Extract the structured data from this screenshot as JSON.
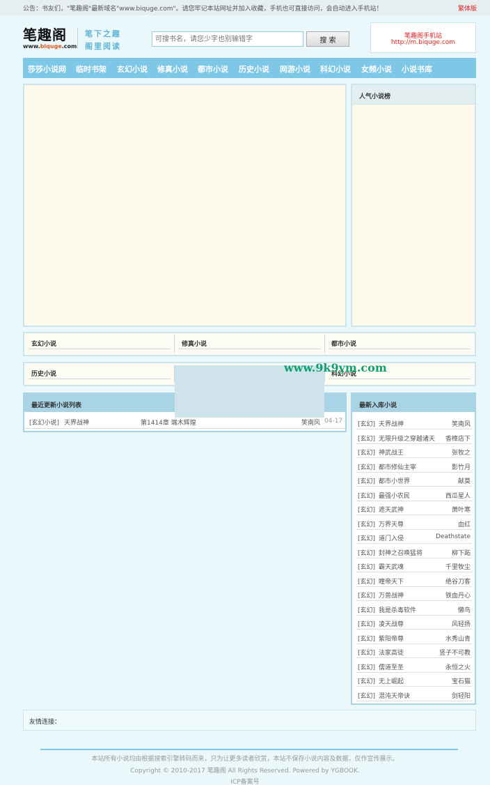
{
  "notice": {
    "text": "公告：书友们，\"笔趣阁\"最新域名\"www.biquge.com\"。请您牢记本站网址并加入收藏，手机也可直接访问，会自动进入手机站！",
    "traditional_label": "繁体版"
  },
  "header": {
    "logo_title": "笔趣阁",
    "logo_url_pre": "www.",
    "logo_url_hl": "biquge",
    "logo_url_post": ".com",
    "slogan_line1": "笔下之趣",
    "slogan_line2": "阁里阅读",
    "search_placeholder": "可搜书名，请您少字也别输错字",
    "search_button": "搜 索",
    "mobile_title": "笔趣阁手机站",
    "mobile_url": "http://m.biquge.com"
  },
  "nav": [
    "莎莎小说网",
    "临时书架",
    "玄幻小说",
    "修真小说",
    "都市小说",
    "历史小说",
    "网游小说",
    "科幻小说",
    "女频小说",
    "小说书库"
  ],
  "popular": {
    "title": "人气小说榜"
  },
  "categories_row1": [
    "玄幻小说",
    "修真小说",
    "都市小说"
  ],
  "categories_row2": [
    "历史小说",
    "",
    "科幻小说"
  ],
  "watermark": "www.9k9ym.com",
  "latest": {
    "title": "最近更新小说列表",
    "rows": [
      {
        "category": "[玄幻小说]",
        "title": "天界战神",
        "chapter": "第1414章 端木辉煌",
        "author": "笑南风",
        "date": "04-17"
      }
    ]
  },
  "newest": {
    "title": "最新入库小说",
    "rows": [
      {
        "category": "[玄幻]",
        "title": "天界战神",
        "author": "笑南风"
      },
      {
        "category": "[玄幻]",
        "title": "无限升级之穿越诸天",
        "author": "香樟店下"
      },
      {
        "category": "[玄幻]",
        "title": "神武战王",
        "author": "张牧之"
      },
      {
        "category": "[玄幻]",
        "title": "都市修仙主宰",
        "author": "影竹月"
      },
      {
        "category": "[玄幻]",
        "title": "都市小世界",
        "author": "献莫"
      },
      {
        "category": "[玄幻]",
        "title": "最强小农民",
        "author": "西瓜星人"
      },
      {
        "category": "[玄幻]",
        "title": "遮天武神",
        "author": "萧叶寒"
      },
      {
        "category": "[玄幻]",
        "title": "万界天尊",
        "author": "血红"
      },
      {
        "category": "[玄幻]",
        "title": "道门入侵",
        "author": "Deathstate"
      },
      {
        "category": "[玄幻]",
        "title": "封神之召唤猛将",
        "author": "柳下跖"
      },
      {
        "category": "[玄幻]",
        "title": "霸天武魂",
        "author": "千里牧尘"
      },
      {
        "category": "[玄幻]",
        "title": "瞳帝天下",
        "author": "绝谷刀客"
      },
      {
        "category": "[玄幻]",
        "title": "万兽战神",
        "author": "铁血丹心"
      },
      {
        "category": "[玄幻]",
        "title": "我是杀毒软件",
        "author": "懒鸟"
      },
      {
        "category": "[玄幻]",
        "title": "凌天战尊",
        "author": "风轻扬"
      },
      {
        "category": "[玄幻]",
        "title": "紫阳帝尊",
        "author": "水秀山青"
      },
      {
        "category": "[玄幻]",
        "title": "法家高徒",
        "author": "竖子不可教"
      },
      {
        "category": "[玄幻]",
        "title": "儒道至圣",
        "author": "永恒之火"
      },
      {
        "category": "[玄幻]",
        "title": "无上崛起",
        "author": "宝石猫"
      },
      {
        "category": "[玄幻]",
        "title": "混沌天帝诀",
        "author": "剑轻阳"
      }
    ]
  },
  "friends": {
    "label": "友情连接："
  },
  "footer": {
    "line1": "本站所有小说均由根据搜索引擎转码而来，只为让更多读者欣赏，本站不保存小说内容及数据，仅作宣传展示。",
    "line2": "Copyright © 2010-2017 笔趣阁 All Rights Reserved. Powered by YGBOOK.",
    "line3": "ICP备案号"
  }
}
